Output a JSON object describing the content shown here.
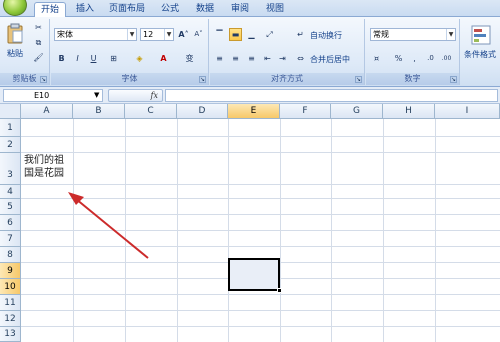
{
  "tabs": [
    "开始",
    "插入",
    "页面布局",
    "公式",
    "数据",
    "审阅",
    "视图"
  ],
  "ribbon": {
    "clipboard": {
      "paste": "粘贴",
      "label": "剪贴板"
    },
    "font": {
      "name": "宋体",
      "size": "12",
      "label": "字体",
      "bold": "B",
      "italic": "I",
      "underline": "U",
      "grow": "A",
      "shrink": "A",
      "phonetic": "变"
    },
    "alignment": {
      "wrap": "自动换行",
      "merge": "合并后居中",
      "label": "对齐方式"
    },
    "number": {
      "format": "常规",
      "label": "数字",
      "percent": "%",
      "comma": ",",
      "dec_inc": ".0",
      "dec_dec": ".00"
    },
    "styles": {
      "conditional": "条件格式"
    }
  },
  "formula_bar": {
    "name_box": "E10",
    "fx": "fx",
    "formula": ""
  },
  "columns": [
    "A",
    "B",
    "C",
    "D",
    "E",
    "F",
    "G",
    "H",
    "I"
  ],
  "rows": [
    "1",
    "2",
    "3",
    "4",
    "5",
    "6",
    "7",
    "8",
    "9",
    "10",
    "11",
    "12",
    "13"
  ],
  "cell_a3": {
    "line1": "我们的祖",
    "line2": "国是花园"
  },
  "colors": {
    "accent_selected_header": "#f7c869",
    "annotation_arrow": "#cc2b2b"
  }
}
